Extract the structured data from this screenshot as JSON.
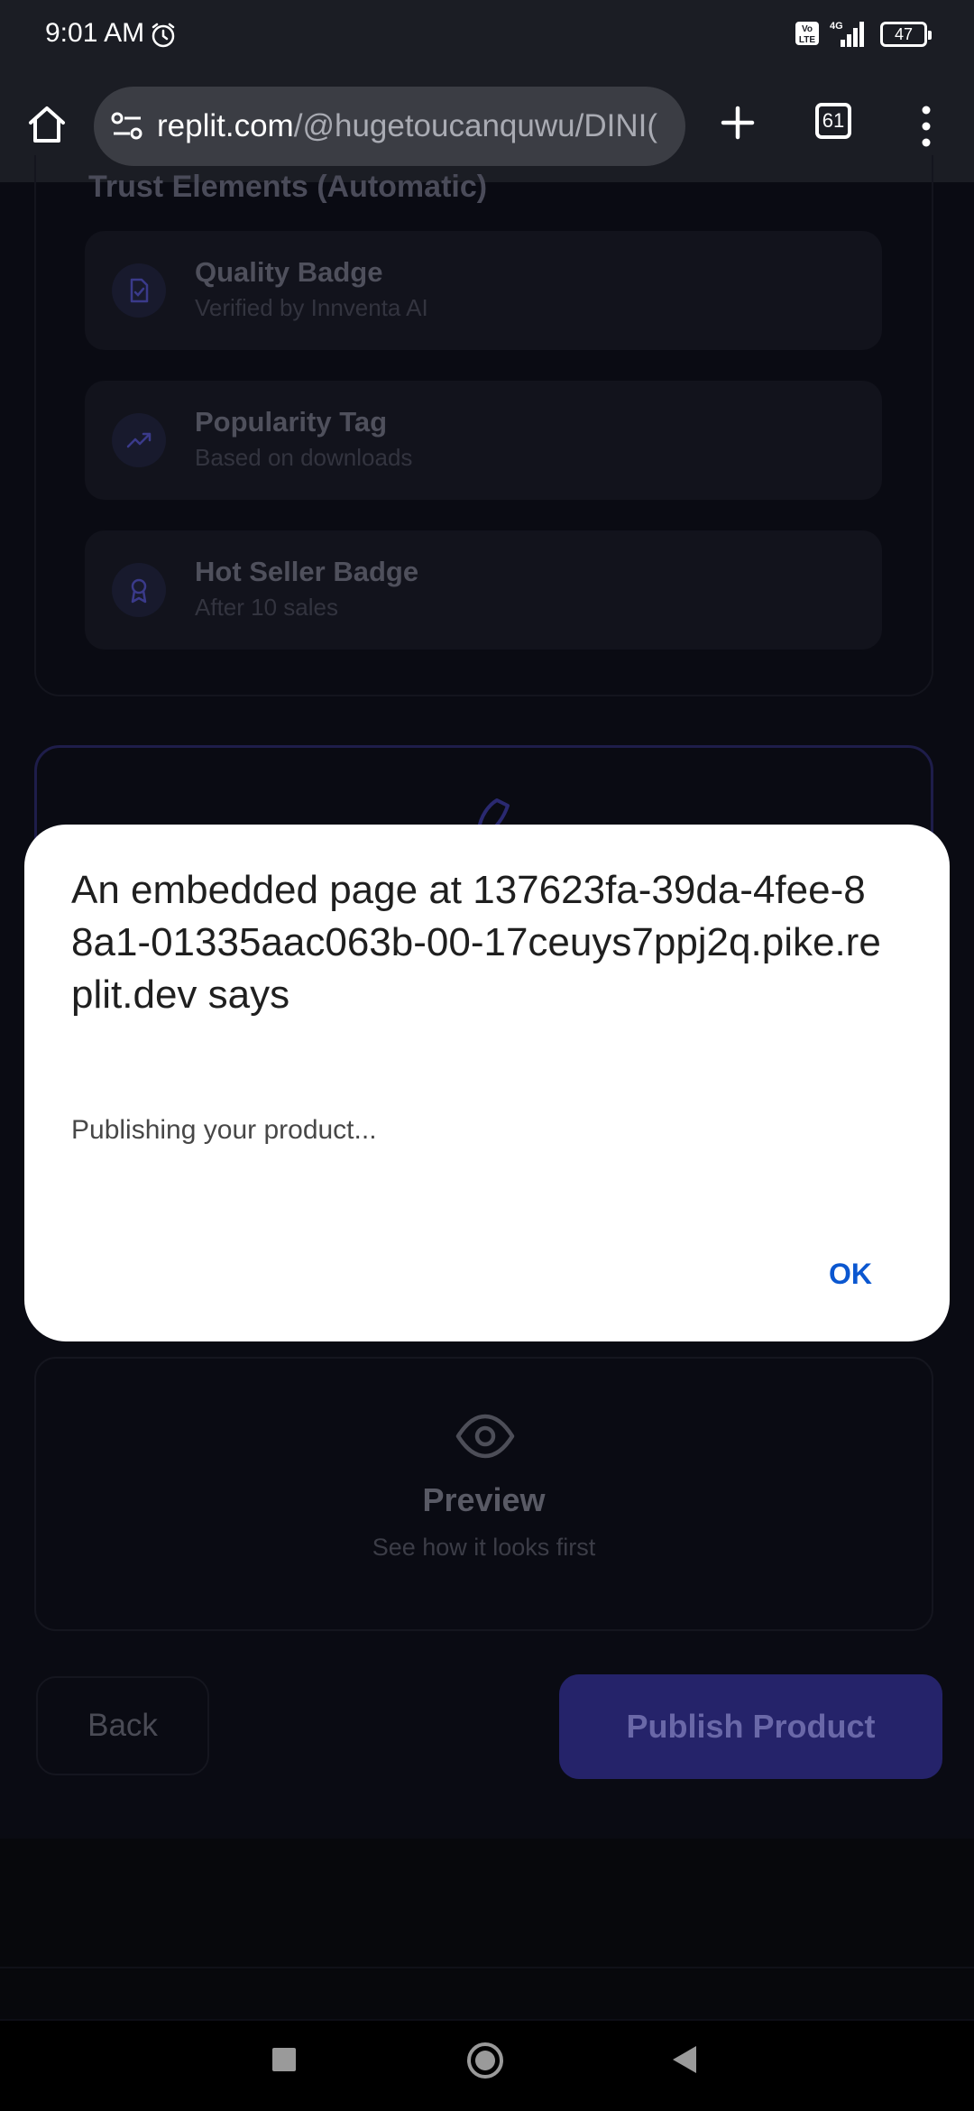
{
  "status_bar": {
    "time": "9:01 AM",
    "volte": "VoLTE",
    "network": "4G",
    "battery": "47"
  },
  "browser": {
    "url_host": "replit.com",
    "url_path": "/@hugetoucanquwu/DINI(",
    "tab_count": "61"
  },
  "page": {
    "section_heading": "Trust Elements (Automatic)",
    "trust_items": [
      {
        "title": "Quality Badge",
        "subtitle": "Verified by Innventa AI",
        "icon": "document-check-icon"
      },
      {
        "title": "Popularity Tag",
        "subtitle": "Based on downloads",
        "icon": "trending-up-icon"
      },
      {
        "title": "Hot Seller Badge",
        "subtitle": "After 10 sales",
        "icon": "award-icon"
      }
    ],
    "preview": {
      "title": "Preview",
      "subtitle": "See how it looks first"
    },
    "back_label": "Back",
    "publish_label": "Publish Product"
  },
  "dialog": {
    "title": "An embedded page at 137623fa-39da-4fee-88a1-01335aac063b-00-17ceuys7ppj2q.pike.replit.dev says",
    "message": "Publishing your product...",
    "ok_label": "OK"
  },
  "colors": {
    "accent": "#0b57d0",
    "publish_button": "#25236a",
    "background": "#0d0e16"
  }
}
